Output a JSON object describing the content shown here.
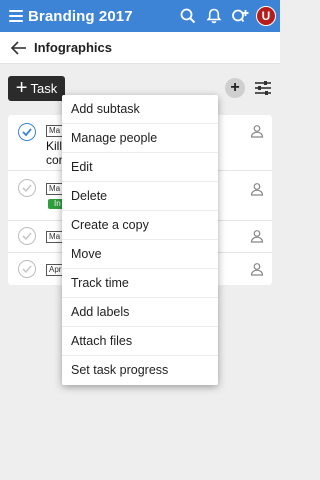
{
  "header": {
    "title": "Branding 2017",
    "avatar_letter": "U",
    "accent": "#3d84d6",
    "icons": [
      "menu-icon",
      "search-icon",
      "bell-icon",
      "add-user-icon"
    ]
  },
  "subheader": {
    "breadcrumb": "Infographics"
  },
  "toolbar": {
    "task_label": "Task",
    "add_icon": "plus-circle-icon",
    "filter_icon": "sliders-icon"
  },
  "tasks": [
    {
      "tag": "Ma",
      "title_visible": "Kill",
      "title_line2": "con",
      "completed": true
    },
    {
      "tag": "Ma",
      "status_label": "In",
      "completed": false
    },
    {
      "tag": "Ma",
      "completed": false
    },
    {
      "tag": "Apr",
      "completed": false
    }
  ],
  "menu": {
    "items": [
      "Add subtask",
      "Manage people",
      "Edit",
      "Delete",
      "Create a copy",
      "Move",
      "Track time",
      "Add labels",
      "Attach files",
      "Set task progress"
    ]
  }
}
